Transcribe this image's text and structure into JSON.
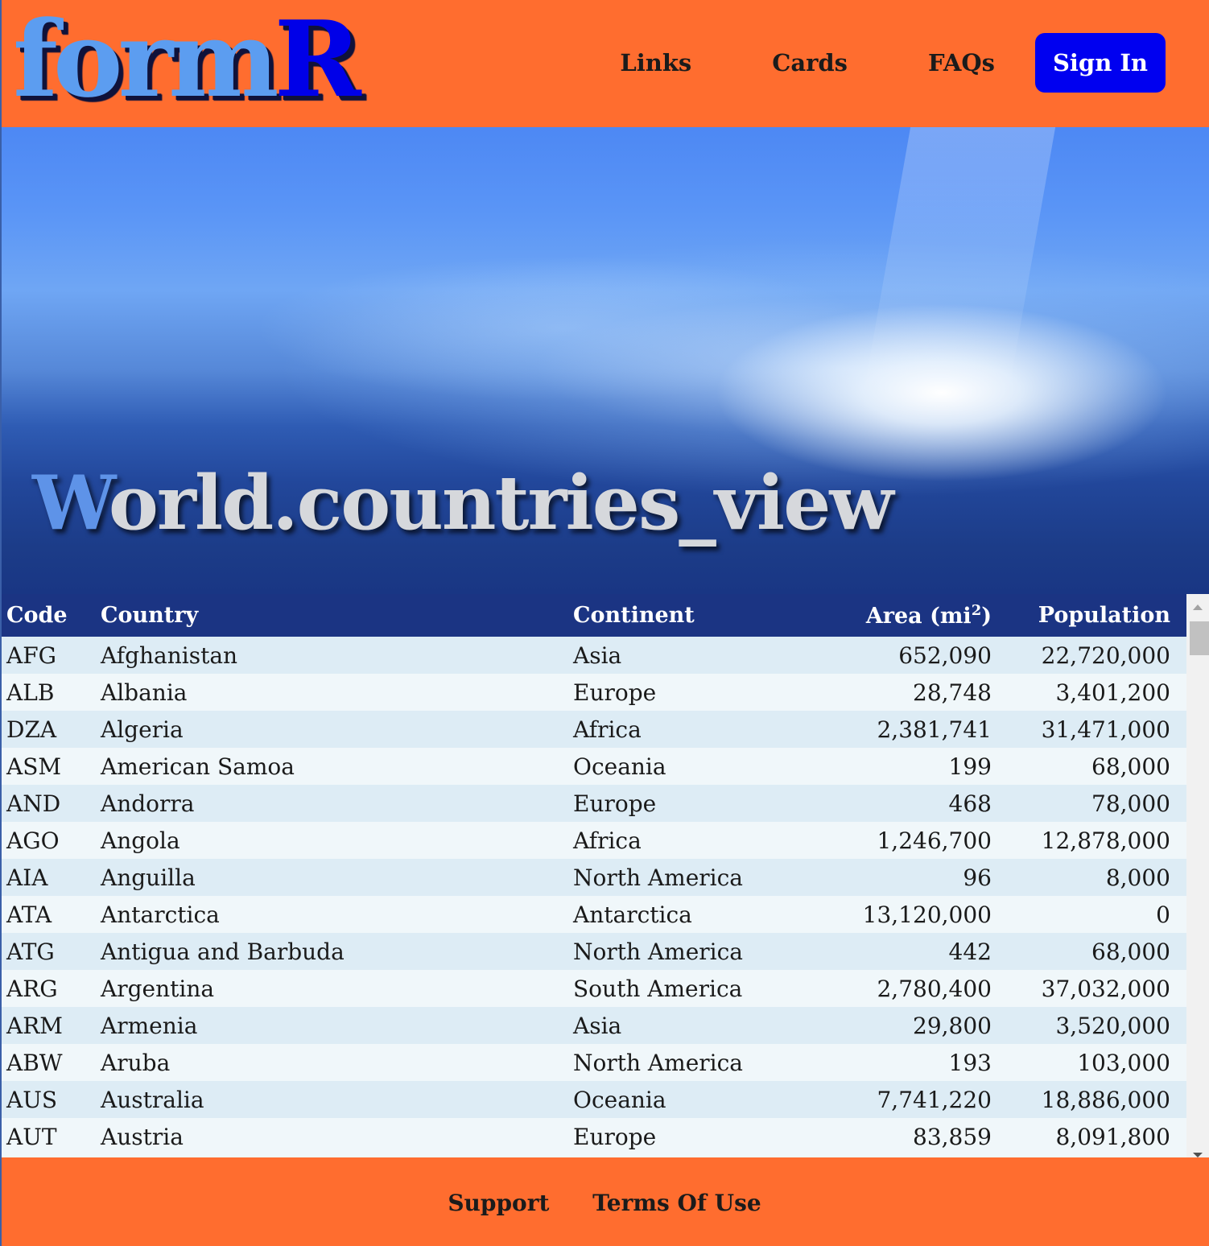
{
  "header": {
    "logo_part1": "form",
    "logo_part2": "R",
    "nav": [
      "Links",
      "Cards",
      "FAQs"
    ],
    "signin_label": "Sign In"
  },
  "hero": {
    "title_first": "W",
    "title_rest": "orld.countries_view"
  },
  "table": {
    "columns": [
      "Code",
      "Country",
      "Continent",
      "Area (mi",
      "Population"
    ],
    "area_sup": "2",
    "area_close": ")",
    "rows": [
      [
        "AFG",
        "Afghanistan",
        "Asia",
        "652,090",
        "22,720,000"
      ],
      [
        "ALB",
        "Albania",
        "Europe",
        "28,748",
        "3,401,200"
      ],
      [
        "DZA",
        "Algeria",
        "Africa",
        "2,381,741",
        "31,471,000"
      ],
      [
        "ASM",
        "American Samoa",
        "Oceania",
        "199",
        "68,000"
      ],
      [
        "AND",
        "Andorra",
        "Europe",
        "468",
        "78,000"
      ],
      [
        "AGO",
        "Angola",
        "Africa",
        "1,246,700",
        "12,878,000"
      ],
      [
        "AIA",
        "Anguilla",
        "North America",
        "96",
        "8,000"
      ],
      [
        "ATA",
        "Antarctica",
        "Antarctica",
        "13,120,000",
        "0"
      ],
      [
        "ATG",
        "Antigua and Barbuda",
        "North America",
        "442",
        "68,000"
      ],
      [
        "ARG",
        "Argentina",
        "South America",
        "2,780,400",
        "37,032,000"
      ],
      [
        "ARM",
        "Armenia",
        "Asia",
        "29,800",
        "3,520,000"
      ],
      [
        "ABW",
        "Aruba",
        "North America",
        "193",
        "103,000"
      ],
      [
        "AUS",
        "Australia",
        "Oceania",
        "7,741,220",
        "18,886,000"
      ],
      [
        "AUT",
        "Austria",
        "Europe",
        "83,859",
        "8,091,800"
      ]
    ]
  },
  "footer": {
    "support_label": "Support",
    "terms_label": "Terms Of Use"
  },
  "colors": {
    "header_bg": "#ff6d2f",
    "signin_bg": "#0000f0",
    "table_header_bg": "#1b3483",
    "row_odd": "#ddecf5",
    "row_even": "#f0f7fa"
  }
}
